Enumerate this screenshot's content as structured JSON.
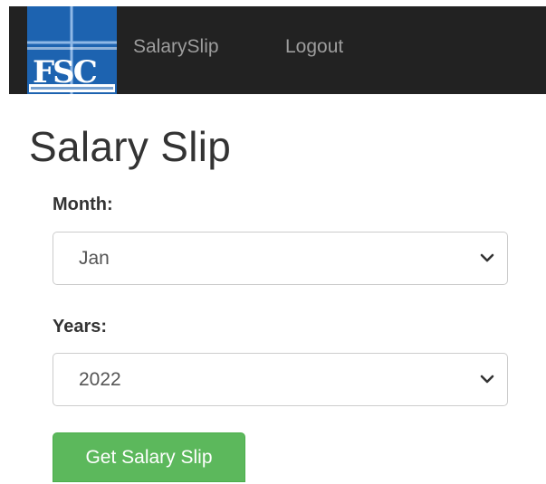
{
  "navbar": {
    "logo": {
      "icon": "fsc-logo",
      "text": "FSC"
    },
    "links": [
      "SalarySlip",
      "Logout"
    ]
  },
  "page": {
    "title": "Salary Slip"
  },
  "form": {
    "month_label": "Month:",
    "month_value": "Jan",
    "years_label": "Years:",
    "years_value": "2022",
    "submit_label": "Get Salary Slip"
  },
  "colors": {
    "navbar_bg": "#222222",
    "nav_link": "#9d9d9d",
    "logo_blue": "#1d63b0",
    "button_green": "#5cb85c"
  }
}
